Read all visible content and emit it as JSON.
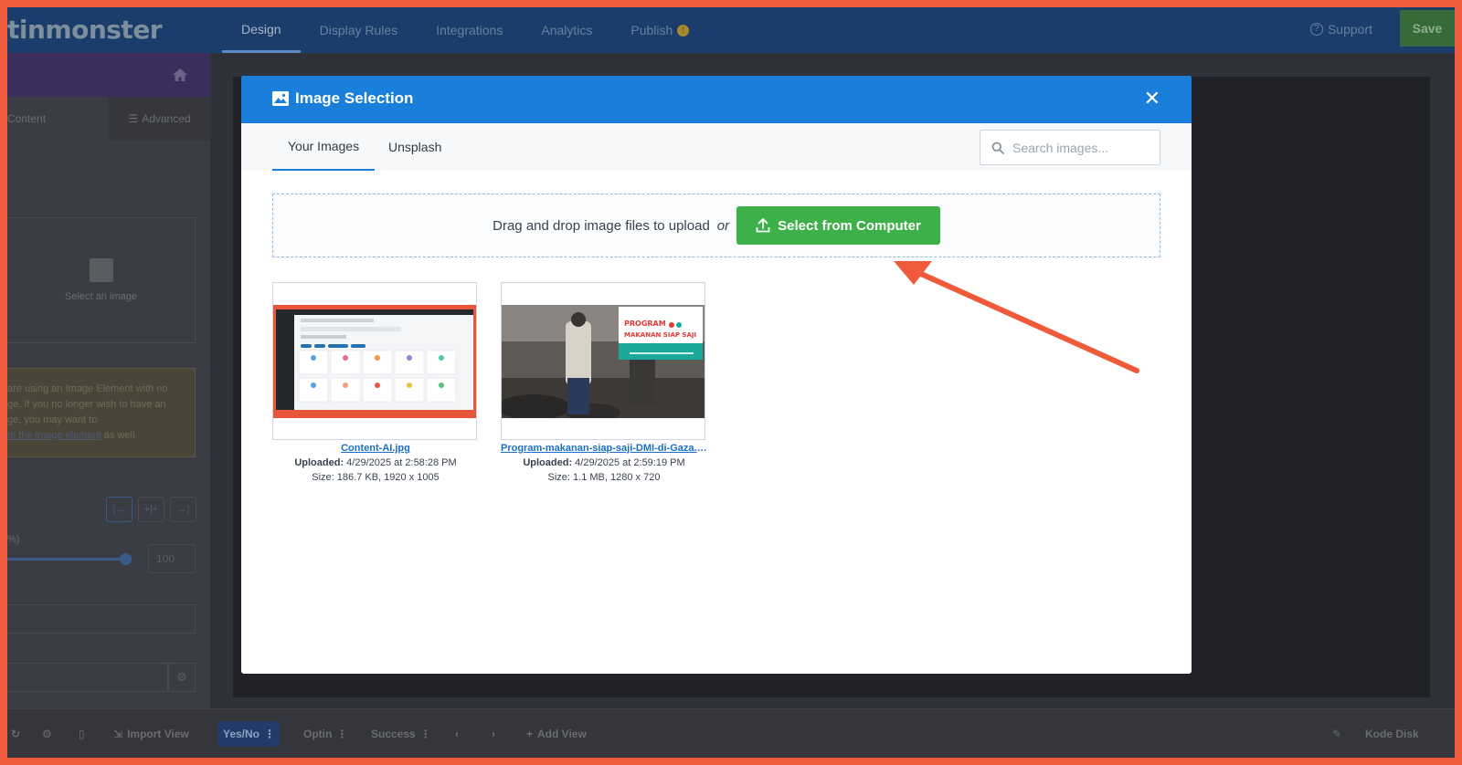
{
  "app": {
    "logo_text": "tinmonster"
  },
  "nav": {
    "tabs": [
      "Design",
      "Display Rules",
      "Integrations",
      "Analytics",
      "Publish"
    ],
    "publish_badge": "!",
    "support_label": "Support",
    "save_label": "Save"
  },
  "sidebar": {
    "tab_content": "Content",
    "tab_advanced": "Advanced",
    "select_image_label": "Select an image",
    "notice_lines": [
      "are using an Image Element with no",
      "ge. If you no longer wish to have an",
      "ge, you may want to"
    ],
    "notice_link": "te the image element",
    "notice_tail": " as well.",
    "percent_label": "%)",
    "width_value": "100"
  },
  "bottom": {
    "import_view": "Import View",
    "views": [
      "Yes/No",
      "Optin",
      "Success"
    ],
    "add_view": "Add View",
    "user_label": "Kode Disk"
  },
  "modal": {
    "title": "Image Selection",
    "tabs": [
      "Your Images",
      "Unsplash"
    ],
    "search_placeholder": "Search images...",
    "dropzone_text": "Drag and drop image files to upload",
    "dropzone_or": "or",
    "upload_button": "Select from Computer",
    "images": [
      {
        "filename": "Content-AI.jpg",
        "uploaded_label": "Uploaded:",
        "uploaded": "4/29/2025 at 2:58:28 PM",
        "size": "Size: 186.7 KB, 1920 x 1005"
      },
      {
        "filename": "Program-makanan-siap-saji-DMI-di-Gaza.p...",
        "uploaded_label": "Uploaded:",
        "uploaded": "4/29/2025 at 2:59:19 PM",
        "size": "Size: 1.1 MB, 1280 x 720",
        "banner_line1": "PROGRAM",
        "banner_line2": "MAKANAN SIAP SAJI"
      }
    ]
  },
  "colors": {
    "accent": "#1a7fdb",
    "success": "#3eb049",
    "annotation_arrow": "#ee5a3a",
    "frame": "#f05a3c"
  }
}
